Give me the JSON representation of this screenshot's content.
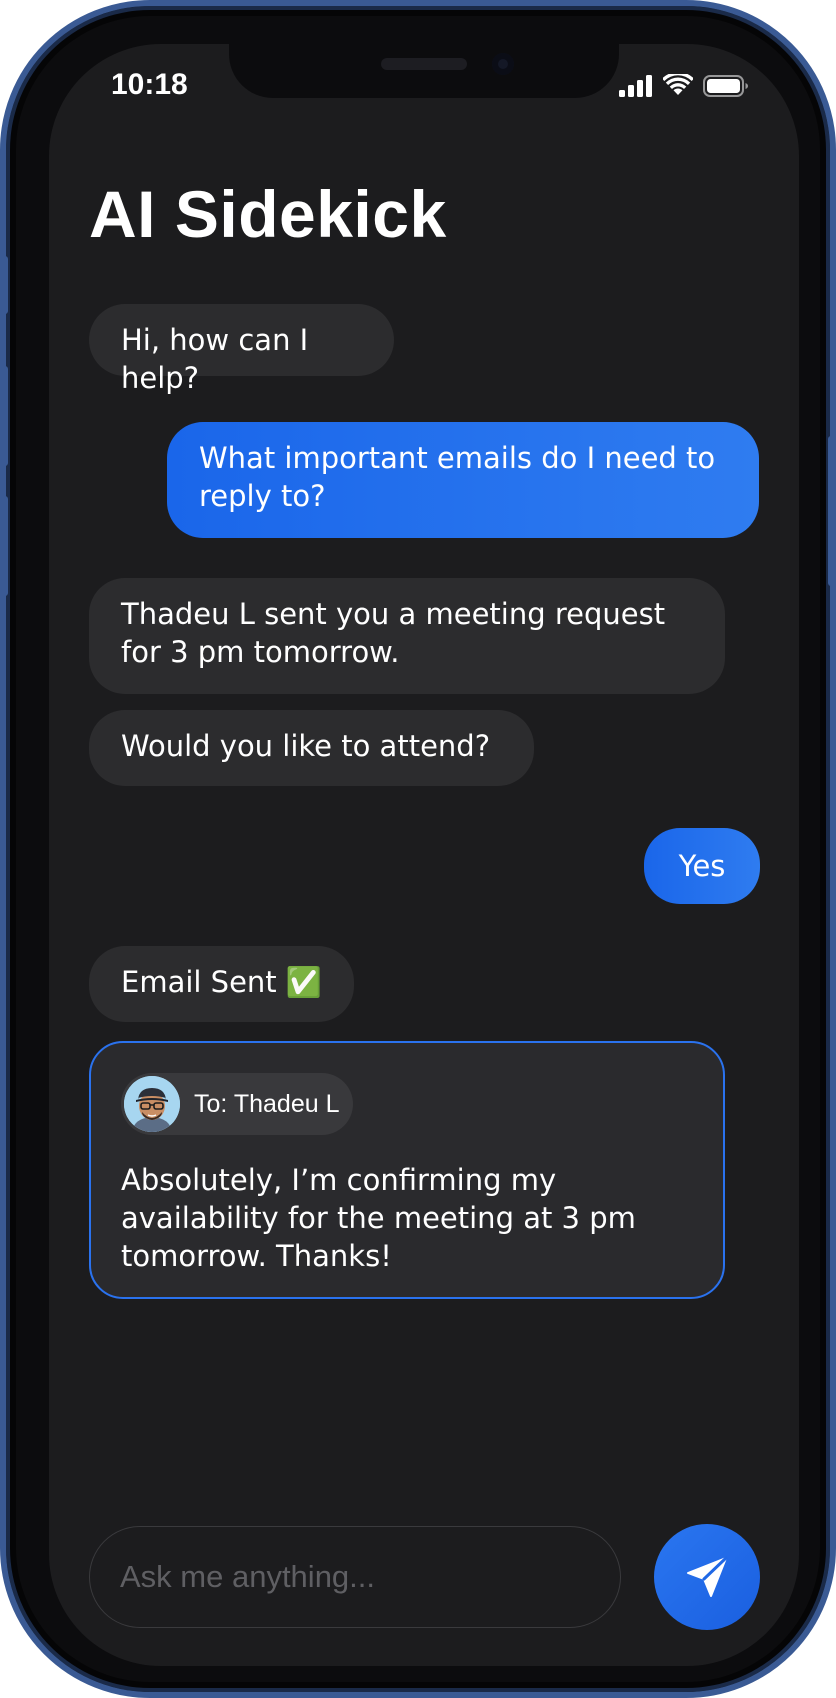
{
  "status_bar": {
    "time": "10:18",
    "icons": [
      "cellular-signal-icon",
      "wifi-icon",
      "battery-icon"
    ]
  },
  "header": {
    "title": "AI Sidekick"
  },
  "messages": [
    {
      "sender": "ai",
      "text": "Hi, how can I help?"
    },
    {
      "sender": "user",
      "text": "What important emails do I need to reply to?"
    },
    {
      "sender": "ai",
      "text": "Thadeu L sent you a meeting request for 3 pm tomorrow."
    },
    {
      "sender": "ai",
      "text": "Would you like to attend?"
    },
    {
      "sender": "user",
      "text": "Yes"
    },
    {
      "sender": "ai",
      "text": "Email Sent ✅"
    }
  ],
  "email_card": {
    "recipient_label": "To: Thadeu L",
    "body": "Absolutely, I’m confirming my availability for the meeting at 3 pm tomorrow. Thanks!"
  },
  "composer": {
    "placeholder": "Ask me anything...",
    "value": ""
  },
  "colors": {
    "accent": "#1a66ea",
    "background": "#1c1c1e",
    "ai_bubble": "#2c2c2e",
    "frame": "#3a5a94"
  }
}
